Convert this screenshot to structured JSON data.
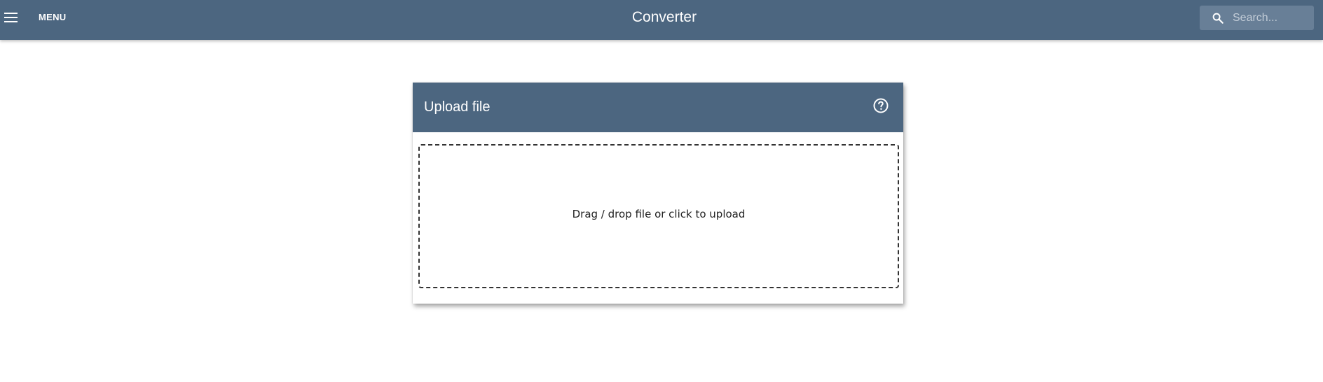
{
  "header": {
    "menu_label": "MENU",
    "title": "Converter",
    "search_placeholder": "Search..."
  },
  "upload_card": {
    "title": "Upload file",
    "dropzone_text": "Drag / drop file or click to upload"
  },
  "icons": {
    "menu": "hamburger-icon",
    "search": "search-icon",
    "help": "help-circle-icon"
  },
  "colors": {
    "primary": "#4c6680",
    "search_bg": "#687f97",
    "background": "#ffffff"
  }
}
